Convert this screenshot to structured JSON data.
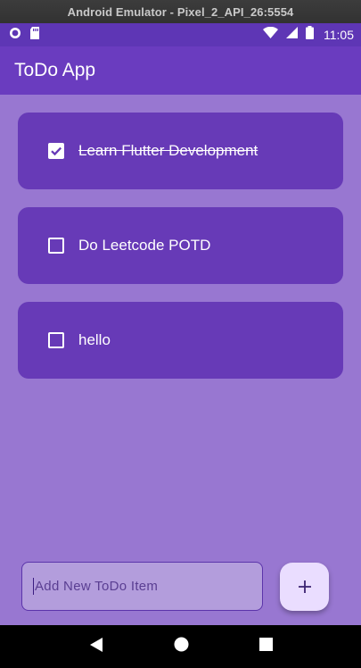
{
  "window": {
    "title": "Android Emulator - Pixel_2_API_26:5554"
  },
  "status_bar": {
    "time": "11:05"
  },
  "app_bar": {
    "title": "ToDo App"
  },
  "todos": [
    {
      "text": "Learn Flutter Development",
      "completed": true
    },
    {
      "text": "Do Leetcode POTD",
      "completed": false
    },
    {
      "text": "hello",
      "completed": false
    }
  ],
  "add_item": {
    "placeholder": "Add New ToDo Item",
    "value": ""
  },
  "colors": {
    "primary": "#673ab7",
    "background": "#9877d1",
    "fab": "#eaddff"
  }
}
